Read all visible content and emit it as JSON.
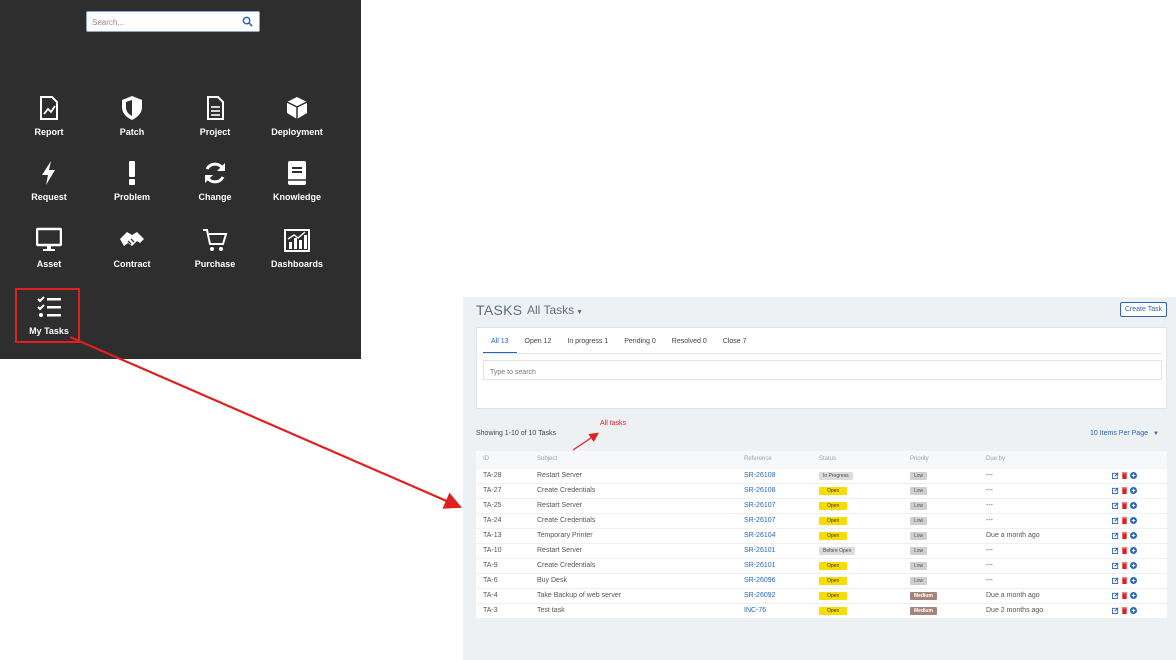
{
  "launcher": {
    "search_placeholder": "Search...",
    "tiles": [
      {
        "label": "Report",
        "icon": "report-icon"
      },
      {
        "label": "Patch",
        "icon": "shield-icon"
      },
      {
        "label": "Project",
        "icon": "document-icon"
      },
      {
        "label": "Deployment",
        "icon": "box-icon"
      },
      {
        "label": "Request",
        "icon": "bolt-icon"
      },
      {
        "label": "Problem",
        "icon": "exclamation-icon"
      },
      {
        "label": "Change",
        "icon": "refresh-icon"
      },
      {
        "label": "Knowledge",
        "icon": "book-icon"
      },
      {
        "label": "Asset",
        "icon": "monitor-icon"
      },
      {
        "label": "Contract",
        "icon": "handshake-icon"
      },
      {
        "label": "Purchase",
        "icon": "cart-icon"
      },
      {
        "label": "Dashboards",
        "icon": "chart-icon"
      },
      {
        "label": "My Tasks",
        "icon": "tasks-list-icon"
      }
    ]
  },
  "annotation": {
    "label": "All tasks",
    "color": "#e02020"
  },
  "tasks": {
    "title": "TASKS",
    "filter": "All Tasks",
    "create_label": "Create Task",
    "tabs": [
      "All 13",
      "Open 12",
      "In progress 1",
      "Pending 0",
      "Resolved 0",
      "Close 7"
    ],
    "active_tab": 0,
    "search_placeholder": "Type to search",
    "showing": "Showing 1-10 of 10 Tasks",
    "per_page": "10 Items Per Page",
    "columns": [
      "ID",
      "Subject",
      "Reference",
      "Status",
      "Priority",
      "Due by"
    ],
    "rows": [
      {
        "id": "TA-28",
        "subject": "Restart Server",
        "reference": "SR-26108",
        "status": "In Progress",
        "priority": "Low",
        "due": "---"
      },
      {
        "id": "TA-27",
        "subject": "Create Credentials",
        "reference": "SR-26108",
        "status": "Open",
        "priority": "Low",
        "due": "---"
      },
      {
        "id": "TA-25",
        "subject": "Restart Server",
        "reference": "SR-26107",
        "status": "Open",
        "priority": "Low",
        "due": "---"
      },
      {
        "id": "TA-24",
        "subject": "Create Credentials",
        "reference": "SR-26107",
        "status": "Open",
        "priority": "Low",
        "due": "---"
      },
      {
        "id": "TA-13",
        "subject": "Temporary Printer",
        "reference": "SR-26104",
        "status": "Open",
        "priority": "Low",
        "due": "Due a month ago"
      },
      {
        "id": "TA-10",
        "subject": "Restart Server",
        "reference": "SR-26101",
        "status": "Before Open",
        "priority": "Low",
        "due": "---"
      },
      {
        "id": "TA-9",
        "subject": "Create Credentials",
        "reference": "SR-26101",
        "status": "Open",
        "priority": "Low",
        "due": "---"
      },
      {
        "id": "TA-6",
        "subject": "Buy Desk",
        "reference": "SR-26096",
        "status": "Open",
        "priority": "Low",
        "due": "---"
      },
      {
        "id": "TA-4",
        "subject": "Take Backup of web server",
        "reference": "SR-26092",
        "status": "Open",
        "priority": "Medium",
        "due": "Due a month ago"
      },
      {
        "id": "TA-3",
        "subject": "Test task",
        "reference": "INC-76",
        "status": "Open",
        "priority": "Medium",
        "due": "Due 2 months ago"
      }
    ]
  },
  "colors": {
    "launcher_bg": "#2e2e2e",
    "accent": "#2966b8",
    "open_badge": "#f7dc00",
    "medium_badge": "#a5847a",
    "arrow": "#e02020"
  }
}
